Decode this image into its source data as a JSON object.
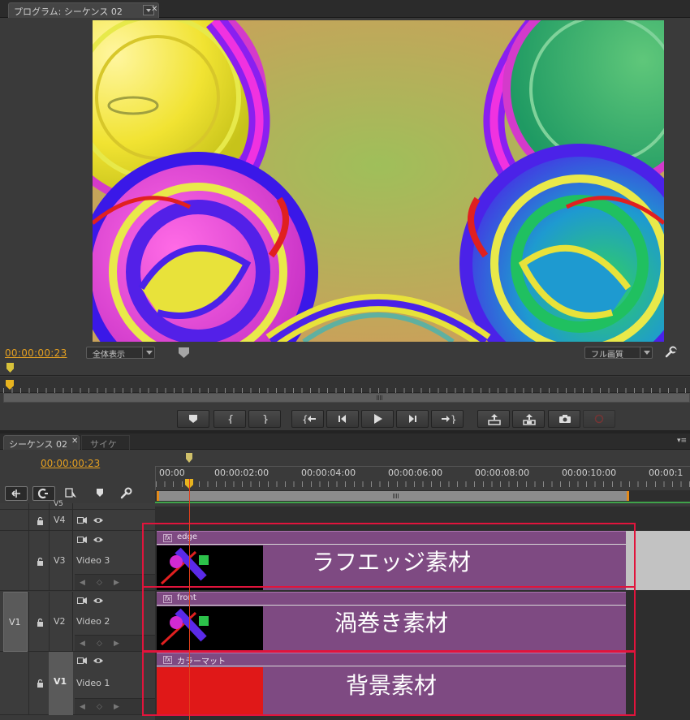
{
  "monitor": {
    "tab_title": "プログラム: シーケンス 02",
    "timecode": "00:00:00:23",
    "zoom_value": "全体表示",
    "quality_value": "フル画質",
    "colors": {
      "timecode": "#e5a021",
      "panel": "#3a3a3a"
    }
  },
  "transport": {
    "buttons": [
      {
        "name": "add-marker-button",
        "icon": "marker-icon"
      },
      {
        "name": "mark-in-button",
        "icon": "bracket-in-icon",
        "label": "{"
      },
      {
        "name": "mark-out-button",
        "icon": "bracket-out-icon",
        "label": "}"
      },
      {
        "name": "go-to-in-button",
        "icon": "go-to-in-icon"
      },
      {
        "name": "step-back-button",
        "icon": "step-back-icon"
      },
      {
        "name": "play-button",
        "icon": "play-icon"
      },
      {
        "name": "step-forward-button",
        "icon": "step-forward-icon"
      },
      {
        "name": "go-to-out-button",
        "icon": "go-to-out-icon"
      },
      {
        "name": "lift-button",
        "icon": "lift-icon"
      },
      {
        "name": "extract-button",
        "icon": "extract-icon"
      },
      {
        "name": "export-frame-button",
        "icon": "camera-icon"
      },
      {
        "name": "button-editor-button",
        "icon": "record-icon"
      }
    ]
  },
  "sequence": {
    "tab_title": "シーケンス 02",
    "tab2_title": "サイケ",
    "timecode": "00:00:00:23",
    "ruler_labels": [
      "00:00",
      "00:00:02:00",
      "00:00:04:00",
      "00:00:06:00",
      "00:00:08:00",
      "00:00:10:00",
      "00:00:1"
    ],
    "tracks": [
      {
        "id": "V5",
        "short": "V5",
        "name": ""
      },
      {
        "id": "V4",
        "short": "V4",
        "name": ""
      },
      {
        "id": "V3",
        "short": "V3",
        "name": "Video 3"
      },
      {
        "id": "V2",
        "short": "V2",
        "name": "Video 2"
      },
      {
        "id": "V1",
        "short": "V1",
        "name": "Video 1"
      }
    ],
    "source_patch": "V1",
    "clips": [
      {
        "name": "edge",
        "overlay": "ラフエッジ素材"
      },
      {
        "name": "front",
        "overlay": "渦巻き素材"
      },
      {
        "name": "カラーマット",
        "overlay": "背景素材"
      }
    ],
    "colors": {
      "clip": "#7e4a82",
      "highlight_box": "#e1143c",
      "color_matte": "#e01818"
    }
  }
}
